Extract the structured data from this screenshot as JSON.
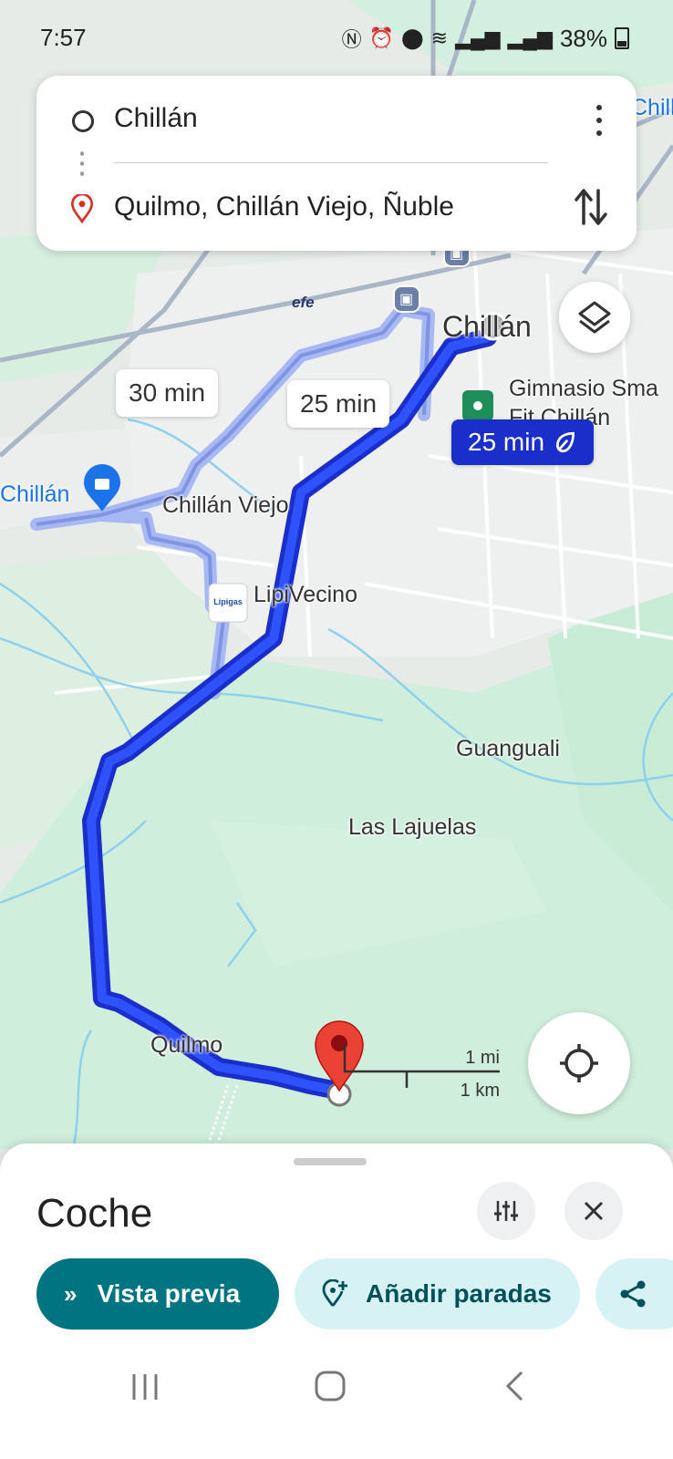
{
  "status_bar": {
    "time": "7:57",
    "battery": "38%"
  },
  "search": {
    "origin": "Chillán",
    "destination": "Quilmo, Chillán Viejo, Ñuble"
  },
  "map": {
    "labels": {
      "chillan_top_right": "Chilla",
      "chillan_city": "Chillán",
      "chillan_left": "Chillán",
      "chillan_viejo": "Chillán Viejo",
      "lipivecino": "LipiVecino",
      "lipigas_logo": "Lipigas",
      "gym_line1": "Gimnasio Sma",
      "gym_line2": "Fit Chillán",
      "guanguali": "Guanguali",
      "las_lajuelas": "Las Lajuelas",
      "quilmo": "Quilmo",
      "efe": "efe"
    },
    "route_alt_1": "30 min",
    "route_alt_2": "25 min",
    "route_selected": "25 min",
    "scale": {
      "miles": "1 mi",
      "km": "1 km"
    },
    "colors": {
      "route": "#1a2fc9",
      "alt_route": "#a7b8f2",
      "water": "#8fd0ec",
      "green": "#cdeedb",
      "urban": "#eceeee"
    }
  },
  "sheet": {
    "title": "Coche",
    "preview_label": "Vista previa",
    "add_stops_label": "Añadir paradas"
  },
  "icons": [
    "signal-icon",
    "alarm-icon",
    "location-icon",
    "wifi-icon",
    "battery-icon",
    "more-vert-icon",
    "swap-icon",
    "layers-icon",
    "my-location-icon",
    "tune-icon",
    "close-icon",
    "chevron-double-icon",
    "add-location-icon",
    "share-icon",
    "recents-icon",
    "home-icon",
    "back-icon"
  ]
}
